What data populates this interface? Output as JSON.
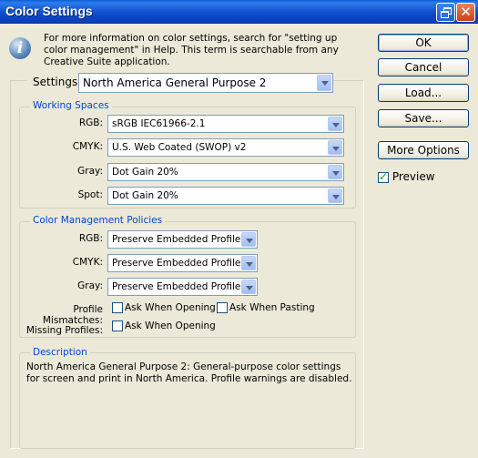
{
  "window": {
    "title": "Color Settings"
  },
  "info": {
    "icon": "info-icon",
    "text": "For more information on color settings, search for \"setting up color management\" in Help. This term is searchable from any Creative Suite application."
  },
  "buttons": {
    "ok": "OK",
    "cancel": "Cancel",
    "load": "Load...",
    "save": "Save...",
    "more_options": "More Options"
  },
  "preview": {
    "label": "Preview",
    "checked": true
  },
  "settings": {
    "label": "Settings:",
    "value": "North America General Purpose 2"
  },
  "working_spaces": {
    "title": "Working Spaces",
    "rows": [
      {
        "label": "RGB:",
        "value": "sRGB IEC61966-2.1"
      },
      {
        "label": "CMYK:",
        "value": "U.S. Web Coated (SWOP) v2"
      },
      {
        "label": "Gray:",
        "value": "Dot Gain 20%"
      },
      {
        "label": "Spot:",
        "value": "Dot Gain 20%"
      }
    ]
  },
  "policies": {
    "title": "Color Management Policies",
    "rows": [
      {
        "label": "RGB:",
        "value": "Preserve Embedded Profiles"
      },
      {
        "label": "CMYK:",
        "value": "Preserve Embedded Profiles"
      },
      {
        "label": "Gray:",
        "value": "Preserve Embedded Profiles"
      }
    ],
    "mismatches_label": "Profile Mismatches:",
    "ask_opening": "Ask When Opening",
    "ask_pasting": "Ask When Pasting",
    "missing_label": "Missing Profiles:",
    "missing_ask_opening": "Ask When Opening"
  },
  "description": {
    "title": "Description",
    "text": "North America General Purpose 2:  General-purpose color settings for screen and print in North America. Profile warnings are disabled."
  }
}
